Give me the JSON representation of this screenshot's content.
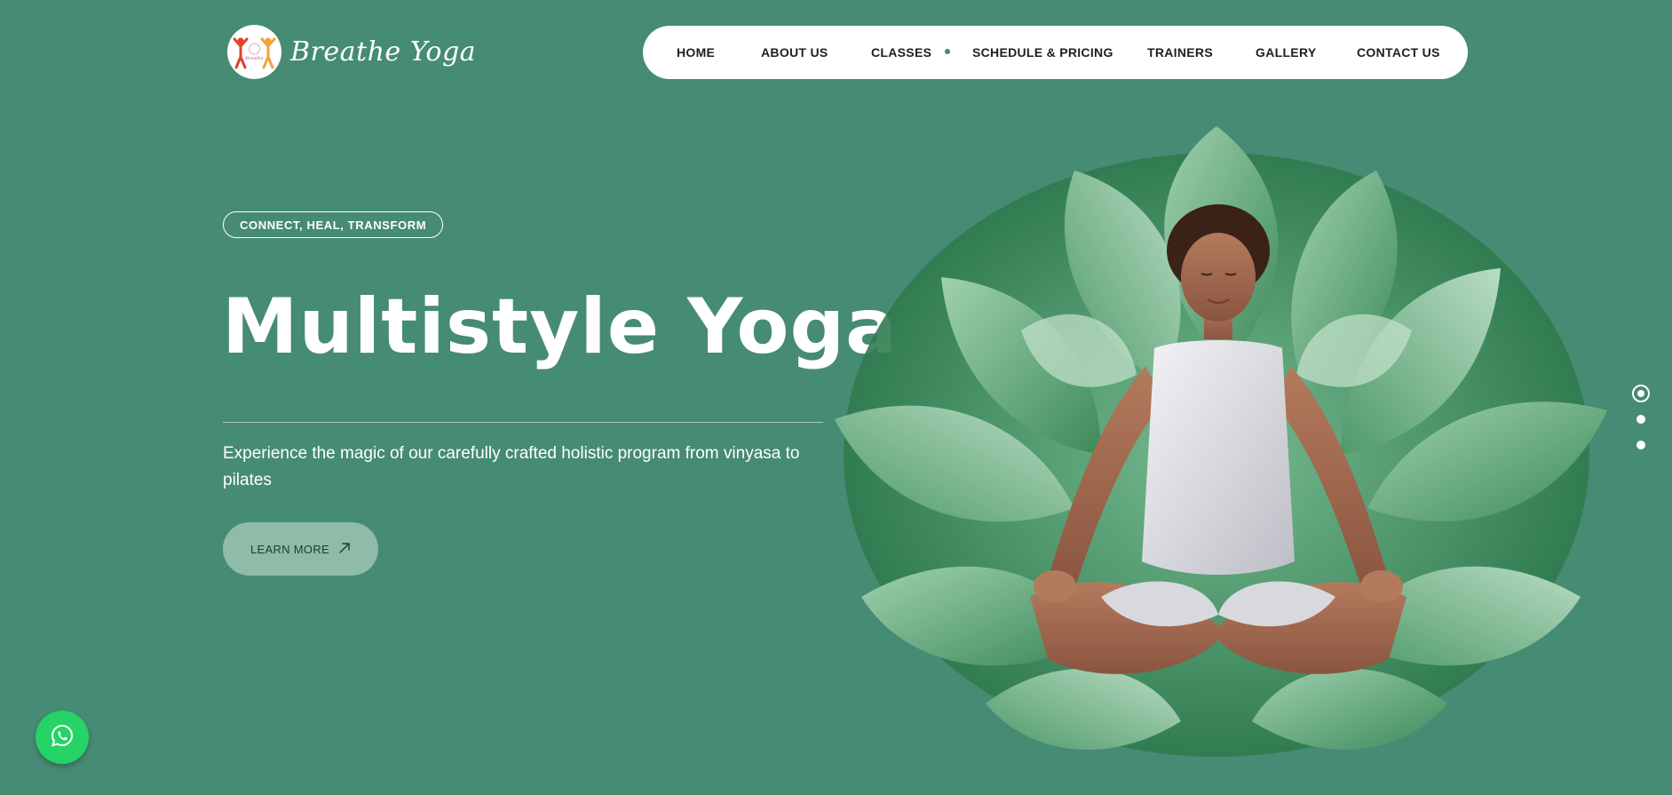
{
  "brand": {
    "name": "Breathe Yoga"
  },
  "nav": {
    "items": [
      {
        "label": "HOME"
      },
      {
        "label": "ABOUT US"
      },
      {
        "label": "CLASSES"
      },
      {
        "label": "SCHEDULE & PRICING"
      },
      {
        "label": "TRAINERS"
      },
      {
        "label": "GALLERY"
      },
      {
        "label": "CONTACT US"
      }
    ]
  },
  "hero": {
    "tagline": "CONNECT, HEAL, TRANSFORM",
    "title": "Multistyle Yoga",
    "description": "Experience the magic of our carefully crafted holistic program from vinyasa to pilates",
    "cta_label": "LEARN MORE"
  },
  "slider": {
    "count": 3,
    "active": 1
  },
  "colors": {
    "background": "#468b74",
    "nav_background": "#ffffff",
    "cta_background": "#8fbba9",
    "whatsapp": "#25d366"
  },
  "icons": {
    "cta": "arrow-up-right-icon",
    "floating": "whatsapp-icon"
  }
}
